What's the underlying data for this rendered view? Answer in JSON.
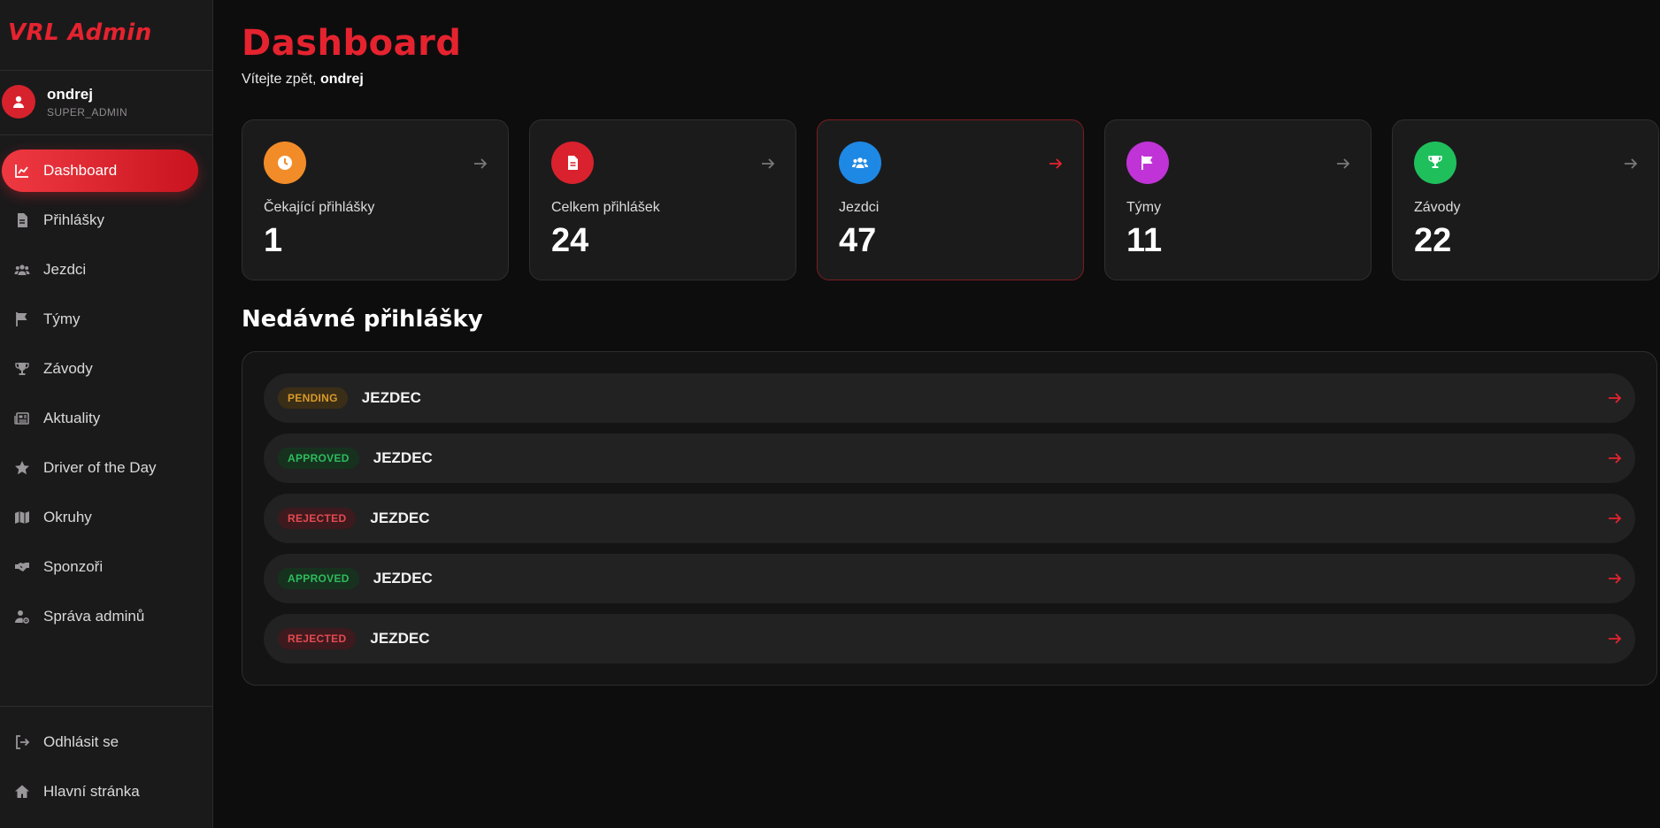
{
  "brand": "VRL Admin",
  "user": {
    "name": "ondrej",
    "role": "SUPER_ADMIN"
  },
  "nav": [
    {
      "label": "Dashboard",
      "icon": "chart-line-icon",
      "active": true
    },
    {
      "label": "Přihlášky",
      "icon": "document-icon"
    },
    {
      "label": "Jezdci",
      "icon": "users-icon"
    },
    {
      "label": "Týmy",
      "icon": "flag-icon"
    },
    {
      "label": "Závody",
      "icon": "trophy-icon"
    },
    {
      "label": "Aktuality",
      "icon": "newspaper-icon"
    },
    {
      "label": "Driver of the Day",
      "icon": "star-icon"
    },
    {
      "label": "Okruhy",
      "icon": "map-icon"
    },
    {
      "label": "Sponzoři",
      "icon": "handshake-icon"
    },
    {
      "label": "Správa adminů",
      "icon": "user-gear-icon"
    }
  ],
  "footer_nav": [
    {
      "label": "Odhlásit se",
      "icon": "logout-icon"
    },
    {
      "label": "Hlavní stránka",
      "icon": "home-icon"
    }
  ],
  "header": {
    "title": "Dashboard",
    "welcome_prefix": "Vítejte zpět, ",
    "welcome_user": "ondrej"
  },
  "stats": [
    {
      "label": "Čekající přihlášky",
      "value": "1",
      "icon": "clock-icon",
      "color": "#f28c28"
    },
    {
      "label": "Celkem přihlášek",
      "value": "24",
      "icon": "document-icon",
      "color": "#d9222e"
    },
    {
      "label": "Jezdci",
      "value": "47",
      "icon": "users-icon",
      "color": "#1e88e5"
    },
    {
      "label": "Týmy",
      "value": "11",
      "icon": "flag-icon",
      "color": "#c033d6"
    },
    {
      "label": "Závody",
      "value": "22",
      "icon": "trophy-icon",
      "color": "#1fbf5c"
    }
  ],
  "recent": {
    "title": "Nedávné přihlášky",
    "rows": [
      {
        "status": "PENDING",
        "name": "JEZDEC"
      },
      {
        "status": "APPROVED",
        "name": "JEZDEC"
      },
      {
        "status": "REJECTED",
        "name": "JEZDEC"
      },
      {
        "status": "APPROVED",
        "name": "JEZDEC"
      },
      {
        "status": "REJECTED",
        "name": "JEZDEC"
      }
    ]
  },
  "colors": {
    "accent": "#e5232f",
    "background": "#0e0d0e",
    "sidebar": "#1b1a1b",
    "card": "#1c1b1c"
  }
}
